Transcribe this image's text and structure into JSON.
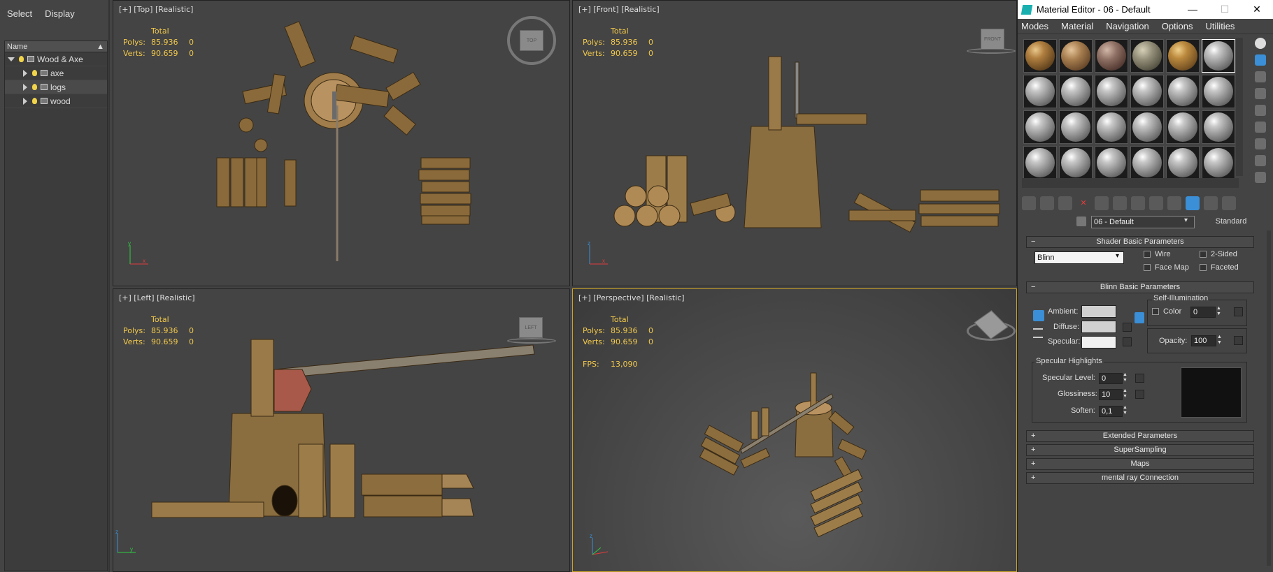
{
  "explorer": {
    "menu": [
      "Select",
      "Display"
    ],
    "column_header": "Name",
    "root": "Wood & Axe",
    "children": [
      "axe",
      "logs",
      "wood"
    ]
  },
  "viewports": [
    {
      "label": "[+] [Top] [Realistic]",
      "nav": "TOP"
    },
    {
      "label": "[+] [Front] [Realistic]",
      "nav": "FRONT"
    },
    {
      "label": "[+] [Left] [Realistic]",
      "nav": "LEFT"
    },
    {
      "label": "[+] [Perspective] [Realistic]",
      "nav": ""
    }
  ],
  "stats": {
    "total": "Total",
    "polys_label": "Polys:",
    "polys_value": "85.936",
    "polys_sel": "0",
    "verts_label": "Verts:",
    "verts_value": "90.659",
    "verts_sel": "0",
    "fps_label": "FPS:",
    "fps_value": "13,090"
  },
  "material_editor": {
    "title": "Material Editor - 06 - Default",
    "menu": [
      "Modes",
      "Material",
      "Navigation",
      "Options",
      "Utilities"
    ],
    "material_name": "06 - Default",
    "material_type": "Standard",
    "shader_rollout": "Shader Basic Parameters",
    "shader_type": "Blinn",
    "wire": "Wire",
    "two_sided": "2-Sided",
    "face_map": "Face Map",
    "faceted": "Faceted",
    "blinn_rollout": "Blinn Basic Parameters",
    "self_illum": "Self-Illumination",
    "color_label": "Color",
    "color_value": "0",
    "ambient": "Ambient:",
    "diffuse": "Diffuse:",
    "specular": "Specular:",
    "opacity_label": "Opacity:",
    "opacity_value": "100",
    "spec_highlights": "Specular Highlights",
    "spec_level_label": "Specular Level:",
    "spec_level_value": "0",
    "glossiness_label": "Glossiness:",
    "glossiness_value": "10",
    "soften_label": "Soften:",
    "soften_value": "0,1",
    "rollouts": [
      "Extended Parameters",
      "SuperSampling",
      "Maps",
      "mental ray Connection"
    ]
  },
  "colors": {
    "stats_text": "#f2c94c",
    "active_viewport_border": "#c9a227",
    "accent_blue": "#3a8fd6"
  }
}
